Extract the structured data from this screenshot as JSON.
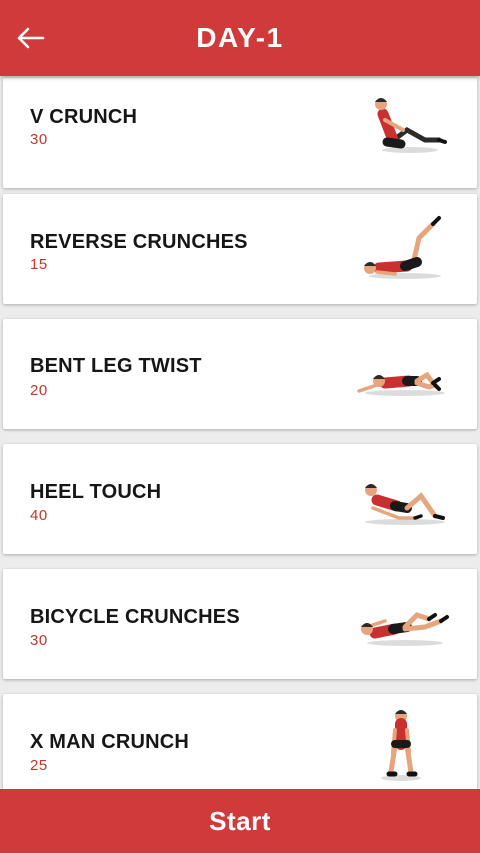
{
  "header": {
    "title": "DAY-1",
    "back_icon": "arrow-left-icon"
  },
  "exercises": [
    {
      "name": "V CRUNCH",
      "count": "30",
      "icon": "v-crunch-figure-icon"
    },
    {
      "name": "REVERSE CRUNCHES",
      "count": "15",
      "icon": "reverse-crunch-figure-icon"
    },
    {
      "name": "BENT LEG TWIST",
      "count": "20",
      "icon": "bent-leg-twist-figure-icon"
    },
    {
      "name": "HEEL TOUCH",
      "count": "40",
      "icon": "heel-touch-figure-icon"
    },
    {
      "name": "BICYCLE CRUNCHES",
      "count": "30",
      "icon": "bicycle-crunch-figure-icon"
    },
    {
      "name": "X MAN CRUNCH",
      "count": "25",
      "icon": "x-man-crunch-figure-icon"
    }
  ],
  "footer": {
    "start_label": "Start"
  },
  "colors": {
    "primary": "#d03a3a",
    "count_text": "#c0392b",
    "background": "#ececec"
  }
}
